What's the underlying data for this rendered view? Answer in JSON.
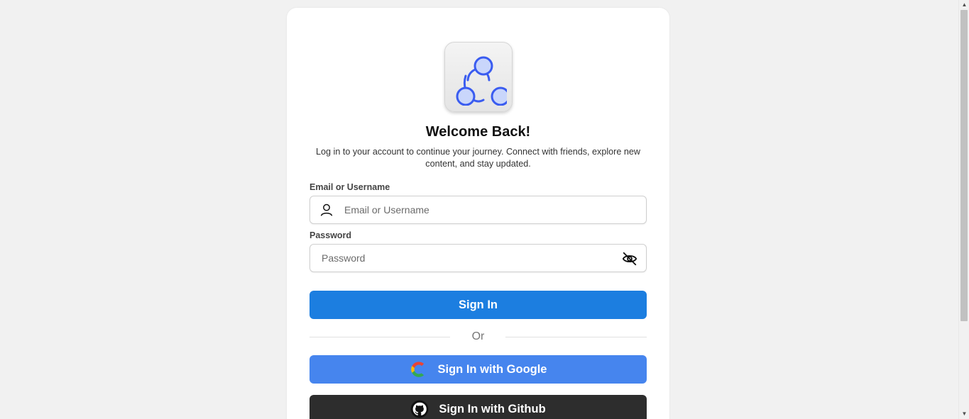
{
  "login": {
    "title": "Welcome Back!",
    "subtitle": "Log in to your account to continue your journey. Connect with friends, explore new content, and stay updated.",
    "email_label": "Email or Username",
    "email_placeholder": "Email or Username",
    "email_value": "",
    "password_label": "Password",
    "password_placeholder": "Password",
    "password_value": "",
    "sign_in_label": "Sign In",
    "divider_text": "Or",
    "google_label": "Sign In with Google",
    "github_label": "Sign In with Github"
  },
  "icons": {
    "logo": "share-network-icon",
    "email": "user-icon",
    "password_toggle": "eye-off-icon",
    "google": "google-icon",
    "github": "github-icon"
  },
  "colors": {
    "background": "#f1f1f1",
    "primary_button": "#1c7ee0",
    "google_button": "#4685ee",
    "github_button": "#2d2d2d",
    "logo_accent": "#3a5cf0"
  }
}
